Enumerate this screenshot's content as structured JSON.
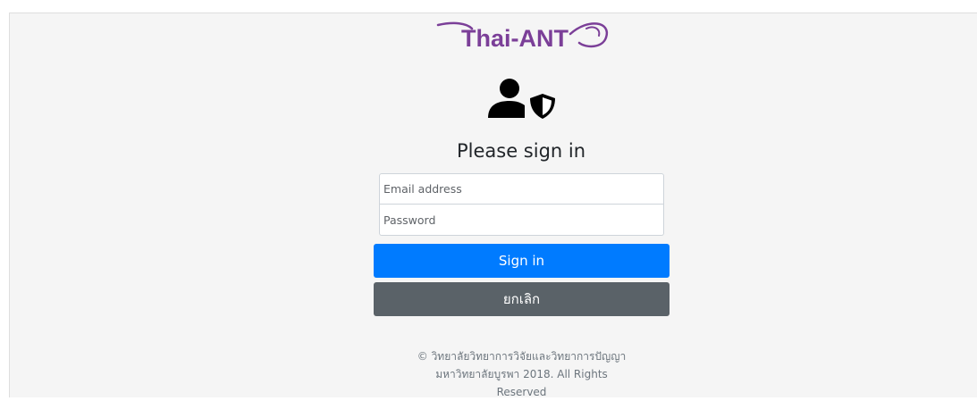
{
  "brand": {
    "logo_text": "Thai-ANT",
    "accent_color": "#7b3f98"
  },
  "icons": {
    "user_shield": "user-shield-icon"
  },
  "form": {
    "title": "Please sign in",
    "email_placeholder": "Email address",
    "password_placeholder": "Password",
    "signin_label": "Sign in",
    "cancel_label": "ยกเลิก"
  },
  "footer": {
    "line1": "© วิทยาลัยวิทยาการวิจัยและวิทยาการปัญญา",
    "line2": "มหาวิทยาลัยบูรพา 2018. All Rights",
    "line3": "Reserved"
  },
  "colors": {
    "primary": "#007bff",
    "secondary": "#5a6268",
    "background": "#f5f5f5"
  }
}
